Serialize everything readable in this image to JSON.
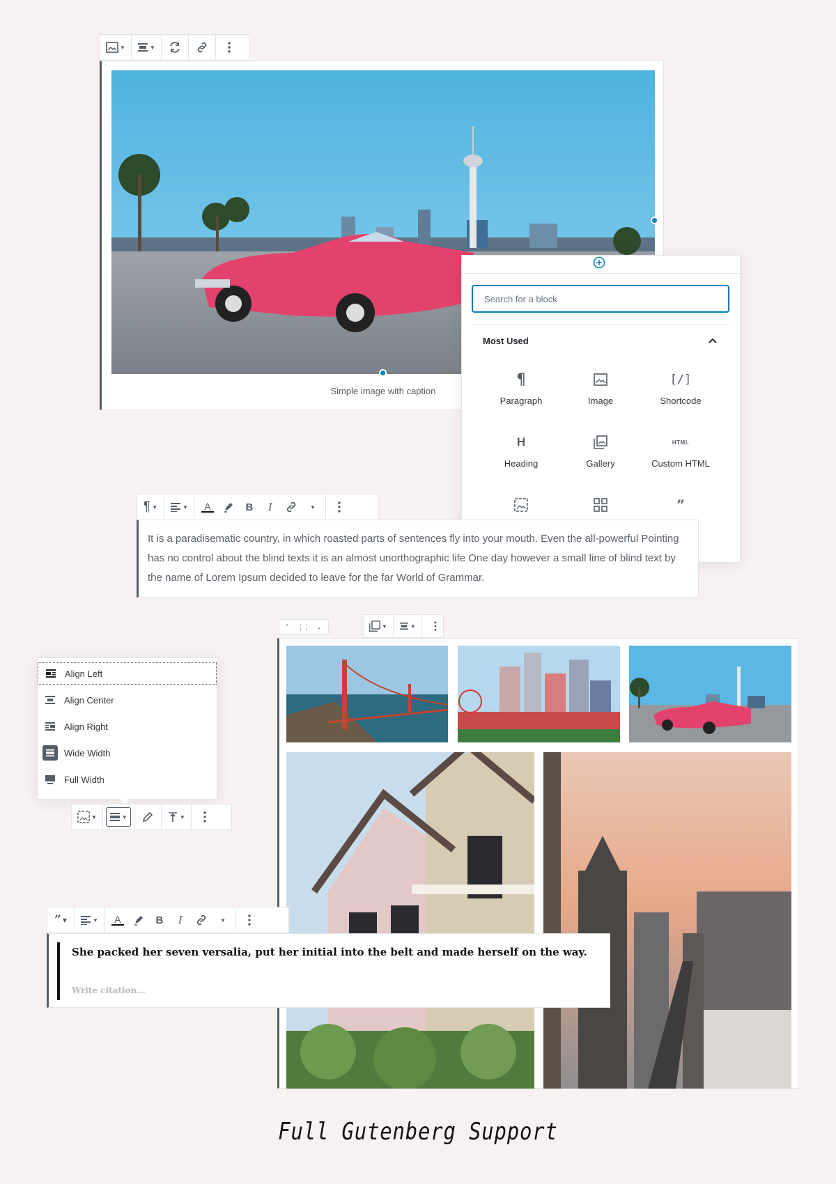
{
  "image_block": {
    "caption": "Simple image with caption",
    "toolbar": {
      "icons": [
        "image-icon",
        "align-center-icon",
        "replace-icon",
        "link-icon",
        "more-options-icon"
      ]
    }
  },
  "inserter": {
    "search_placeholder": "Search for a block",
    "section_title": "Most Used",
    "blocks": [
      {
        "label": "Paragraph",
        "icon": "¶"
      },
      {
        "label": "Image",
        "icon": "image"
      },
      {
        "label": "Shortcode",
        "icon": "[/]"
      },
      {
        "label": "Heading",
        "icon": "H"
      },
      {
        "label": "Gallery",
        "icon": "gallery"
      },
      {
        "label": "Custom HTML",
        "icon": "HTML"
      },
      {
        "label": "",
        "icon": "cover"
      },
      {
        "label": "",
        "icon": "columns"
      },
      {
        "label": "",
        "icon": "quote"
      }
    ]
  },
  "paragraph_block": {
    "text": "It is a paradisematic country, in which roasted parts of sentences fly into your mouth. Even the all-powerful Pointing has no control about the blind texts it is an almost unorthographic life One day however a small line of blind text by the name of Lorem Ipsum decided to leave for the far World of Grammar."
  },
  "align_menu": {
    "items": [
      {
        "label": "Align Left"
      },
      {
        "label": "Align Center"
      },
      {
        "label": "Align Right"
      },
      {
        "label": "Wide Width"
      },
      {
        "label": "Full Width"
      }
    ]
  },
  "quote_block": {
    "text": "She packed her seven versalia, put her initial into the belt and made herself on the way.",
    "citation_placeholder": "Write citation..."
  },
  "footer": {
    "title": "Full Gutenberg Support"
  },
  "colors": {
    "background": "#f7f1f1",
    "accent": "#0085ba",
    "toolbar_icon": "#555d66"
  }
}
